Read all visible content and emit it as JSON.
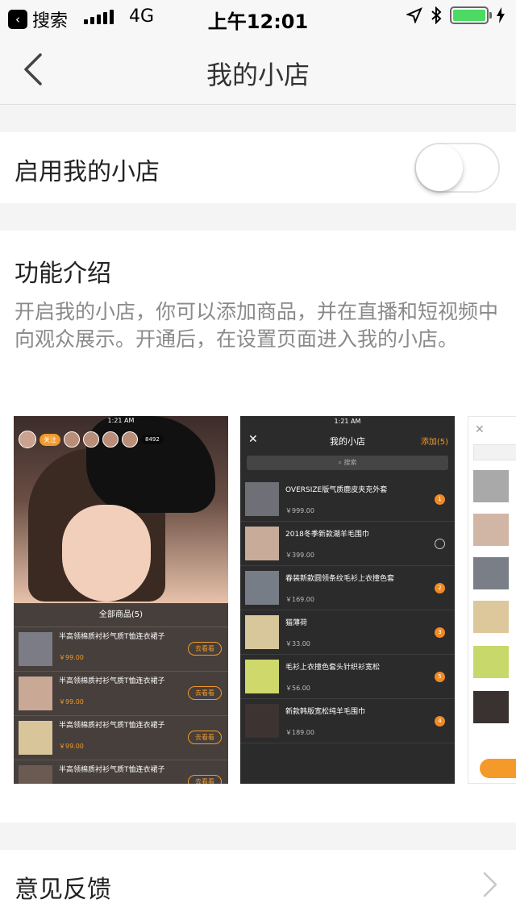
{
  "statusbar": {
    "back_app": "搜索",
    "network": "4G",
    "time": "上午12:01"
  },
  "navbar": {
    "title": "我的小店"
  },
  "enable_row": {
    "label": "启用我的小店",
    "enabled": false
  },
  "intro": {
    "heading": "功能介绍",
    "description": "开启我的小店，你可以添加商品，并在直播和短视频中向观众展示。开通后，在设置页面进入我的小店。"
  },
  "preview1": {
    "status_time": "1:21 AM",
    "follow_label": "关注",
    "viewer_count": "8492",
    "panel_title": "全部商品(5)",
    "items": [
      {
        "name": "半高领棉质衬衫气质T恤连衣裙子",
        "price": "￥99.00",
        "action": "去看看"
      },
      {
        "name": "半高领棉质衬衫气质T恤连衣裙子",
        "price": "￥99.00",
        "action": "去看看"
      },
      {
        "name": "半高领棉质衬衫气质T恤连衣裙子",
        "price": "￥99.00",
        "action": "去看看"
      },
      {
        "name": "半高领棉质衬衫气质T恤连衣裙子",
        "price": "",
        "action": "去看看"
      }
    ]
  },
  "preview2": {
    "status_time": "1:21 AM",
    "close": "✕",
    "title": "我的小店",
    "add_label": "添加(5)",
    "search_placeholder": "搜索",
    "items": [
      {
        "name": "OVERSIZE版气质鹿皮夹克外套",
        "price": "￥999.00",
        "badge": "1"
      },
      {
        "name": "2018冬季新款潮羊毛围巾",
        "price": "￥399.00",
        "badge": ""
      },
      {
        "name": "春装新款圆领条纹毛衫上衣撞色套",
        "price": "￥169.00",
        "badge": "2"
      },
      {
        "name": "猫薄荷",
        "price": "￥33.00",
        "badge": "3"
      },
      {
        "name": "毛衫上衣撞色套头针织衫宽松",
        "price": "￥56.00",
        "badge": "5"
      },
      {
        "name": "新款韩版宽松纯羊毛围巾",
        "price": "￥189.00",
        "badge": "4"
      }
    ]
  },
  "preview3": {
    "close": "✕"
  },
  "feedback_row": {
    "label": "意见反馈"
  },
  "colors": {
    "accent": "#f39a2a",
    "page_bg": "#f4f4f4",
    "battery": "#4cd964"
  }
}
